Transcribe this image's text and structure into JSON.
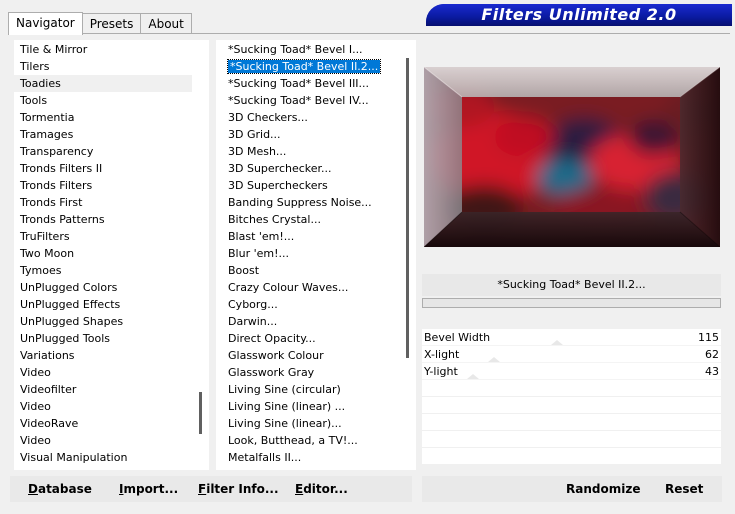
{
  "tabs": [
    "Navigator",
    "Presets",
    "About"
  ],
  "banner_title": "Filters Unlimited 2.0",
  "categories": [
    "Tile & Mirror",
    "Tilers",
    "Toadies",
    "Tools",
    "Tormentia",
    "Tramages",
    "Transparency",
    "Tronds Filters II",
    "Tronds Filters",
    "Tronds First",
    "Tronds Patterns",
    "TruFilters",
    "Two Moon",
    "Tymoes",
    "UnPlugged Colors",
    "UnPlugged Effects",
    "UnPlugged Shapes",
    "UnPlugged Tools",
    "Variations",
    "Video",
    "Videofilter",
    "Video",
    "VideoRave",
    "Video",
    "Visual Manipulation"
  ],
  "selected_category_index": 2,
  "filters": [
    "*Sucking Toad*  Bevel I...",
    "*Sucking Toad*  Bevel II.2...",
    "*Sucking Toad*  Bevel III...",
    "*Sucking Toad*  Bevel IV...",
    "3D Checkers...",
    "3D Grid...",
    "3D Mesh...",
    "3D Superchecker...",
    "3D Supercheckers",
    "Banding Suppress Noise...",
    "Bitches Crystal...",
    "Blast 'em!...",
    "Blur 'em!...",
    "Boost",
    "Crazy Colour Waves...",
    "Cyborg...",
    "Darwin...",
    "Direct Opacity...",
    "Glasswork Colour",
    "Glasswork Gray",
    "Living Sine (circular)",
    "Living Sine (linear) ...",
    "Living Sine (linear)...",
    "Look, Butthead, a TV!...",
    "Metalfalls II..."
  ],
  "selected_filter_index": 1,
  "selected_filter_name": "*Sucking Toad*  Bevel II.2...",
  "params": [
    {
      "name": "Bevel Width",
      "value": "115",
      "level": 0.45
    },
    {
      "name": "X-light",
      "value": "62",
      "level": 0.24
    },
    {
      "name": "Y-light",
      "value": "43",
      "level": 0.17
    }
  ],
  "buttons": {
    "database": {
      "first": "D",
      "rest": "atabase"
    },
    "import": {
      "first": "I",
      "rest": "mport..."
    },
    "filter_info": {
      "first": "F",
      "rest": "ilter Info..."
    },
    "editor": {
      "first": "E",
      "rest": "ditor..."
    },
    "randomize": "Randomize",
    "reset": "Reset"
  },
  "colors": {
    "selection": "#0078d7",
    "banner": "#0a1aa0"
  }
}
